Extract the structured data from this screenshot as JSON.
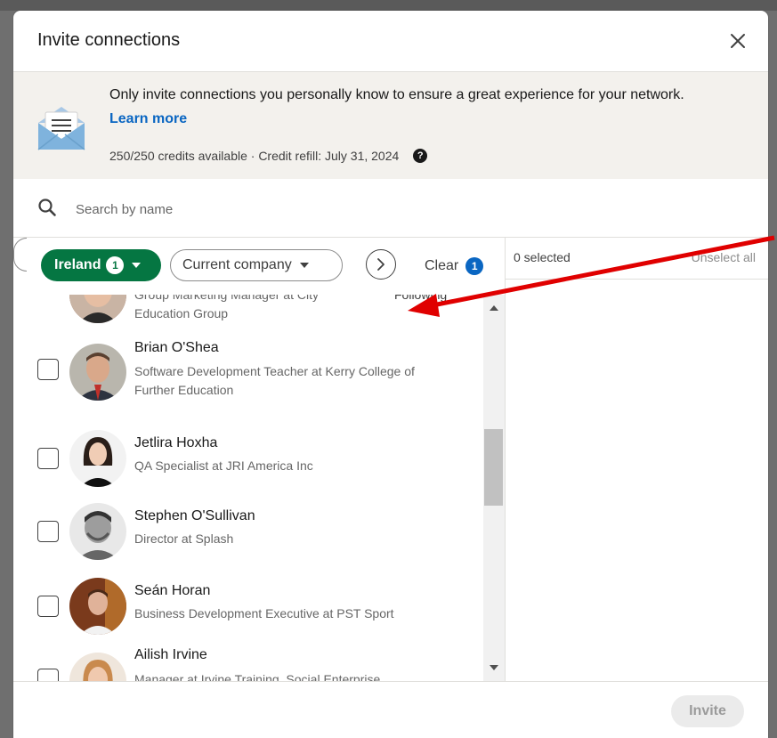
{
  "modal": {
    "title": "Invite connections"
  },
  "notice": {
    "text": "Only invite connections you personally know to ensure a great experience for your network.",
    "link_label": "Learn more",
    "credits": "250/250 credits available · Credit refill: July 31, 2024"
  },
  "search": {
    "placeholder": "Search by name"
  },
  "filters": {
    "ireland_label": "Ireland",
    "ireland_count": "1",
    "company_label": "Current company",
    "clear_label": "Clear",
    "clear_count": "1"
  },
  "list": {
    "partial_top": {
      "subtitle_line1": "Group Marketing Manager at City",
      "subtitle_line2": "Education Group",
      "following": "Following"
    },
    "people": [
      {
        "name": "Brian O'Shea",
        "subtitle": "Software Development Teacher at Kerry College of Further Education"
      },
      {
        "name": "Jetlira Hoxha",
        "subtitle": "QA Specialist at JRI America Inc"
      },
      {
        "name": "Stephen O'Sullivan",
        "subtitle": "Director at Splash"
      },
      {
        "name": "Seán Horan",
        "subtitle": "Business Development Executive at PST Sport"
      },
      {
        "name": "Ailish Irvine",
        "subtitle": "Manager at Irvine Training, Social Enterprise"
      }
    ]
  },
  "selection": {
    "count_label": "0 selected",
    "unselect_label": "Unselect all"
  },
  "footer": {
    "invite_label": "Invite"
  },
  "colors": {
    "brand_blue": "#0a66c2",
    "filter_green": "#057642",
    "annotation_red": "#e00000"
  },
  "icons": {
    "close": "close-icon",
    "envelope": "envelope-icon",
    "help": "help-icon",
    "search": "search-icon",
    "chevron": "chevron-right-icon"
  }
}
